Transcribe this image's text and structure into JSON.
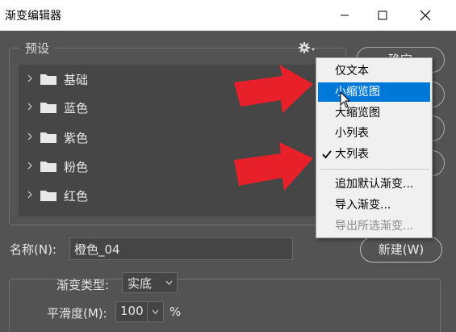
{
  "window": {
    "title": "渐变编辑器"
  },
  "presets": {
    "legend": "预设",
    "folders": [
      {
        "label": "基础"
      },
      {
        "label": "蓝色"
      },
      {
        "label": "紫色"
      },
      {
        "label": "粉色"
      },
      {
        "label": "红色"
      }
    ]
  },
  "right_buttons": {
    "ok_partial": "确定"
  },
  "name": {
    "label": "名称(N):",
    "value": "橙色_04"
  },
  "new_button": "新建(W)",
  "gradient": {
    "type_label": "渐变类型:",
    "type_value": "实底",
    "smoothness_label": "平滑度(M):",
    "smoothness_value": "100",
    "percent": "%"
  },
  "menu": {
    "items": [
      {
        "label": "仅文本"
      },
      {
        "label": "小缩览图",
        "active": true
      },
      {
        "label": "大缩览图"
      },
      {
        "label": "小列表"
      },
      {
        "label": "大列表",
        "checked": true
      },
      {
        "label": "追加默认渐变..."
      },
      {
        "label": "导入渐变..."
      },
      {
        "label": "导出所选渐变...",
        "disabled": true
      }
    ]
  },
  "colors": {
    "dialog_bg": "#535353",
    "list_bg": "#464646",
    "menu_bg": "#f0f0f0",
    "menu_highlight": "#0078d7",
    "annotation_arrow": "#e8202a"
  }
}
